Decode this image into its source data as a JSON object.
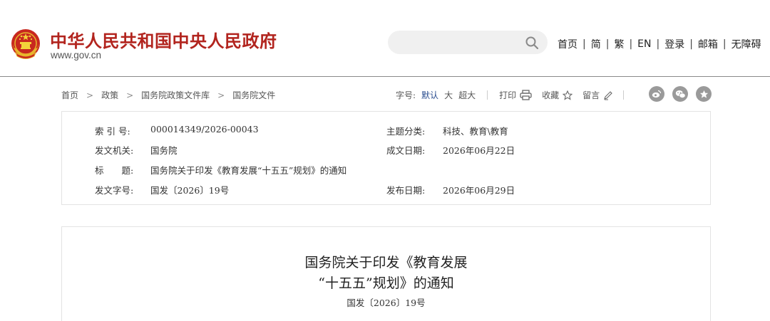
{
  "header": {
    "site_name": "中华人民共和国中央人民政府",
    "site_url": "www.gov.cn",
    "search": {
      "value": "",
      "placeholder": ""
    },
    "nav": [
      "首页",
      "简",
      "繁",
      "EN",
      "登录",
      "邮箱",
      "无障碍"
    ]
  },
  "breadcrumb": [
    "首页",
    "政策",
    "国务院政策文件库",
    "国务院文件"
  ],
  "tools": {
    "font_size_label": "字号:",
    "font_options": [
      "默认",
      "大",
      "超大"
    ],
    "print": "打印",
    "favorite": "收藏",
    "comment": "留言"
  },
  "share_icons": [
    "weibo-icon",
    "wechat-icon",
    "favorite-star-icon"
  ],
  "meta": {
    "index_no": {
      "label": "索 引 号:",
      "value": "000014349/2026-00043"
    },
    "category": {
      "label": "主题分类:",
      "value": "科技、教育\\教育"
    },
    "issuer": {
      "label": "发文机关:",
      "value": "国务院"
    },
    "created": {
      "label": "成文日期:",
      "value": "2026年06月22日"
    },
    "title": {
      "label": "标　　题:",
      "value": "国务院关于印发《教育发展“十五五”规划》的通知"
    },
    "doc_no": {
      "label": "发文字号:",
      "value": "国发〔2026〕19号"
    },
    "published": {
      "label": "发布日期:",
      "value": "2026年06月29日"
    }
  },
  "article": {
    "title_line1": "国务院关于印发《教育发展",
    "title_line2": "“十五五”规划》的通知",
    "doc_no": "国发〔2026〕19号"
  },
  "colors": {
    "brand_red": "#b2241e",
    "emblem_gold": "#e8b62c",
    "active_blue": "#2a4d8f"
  }
}
